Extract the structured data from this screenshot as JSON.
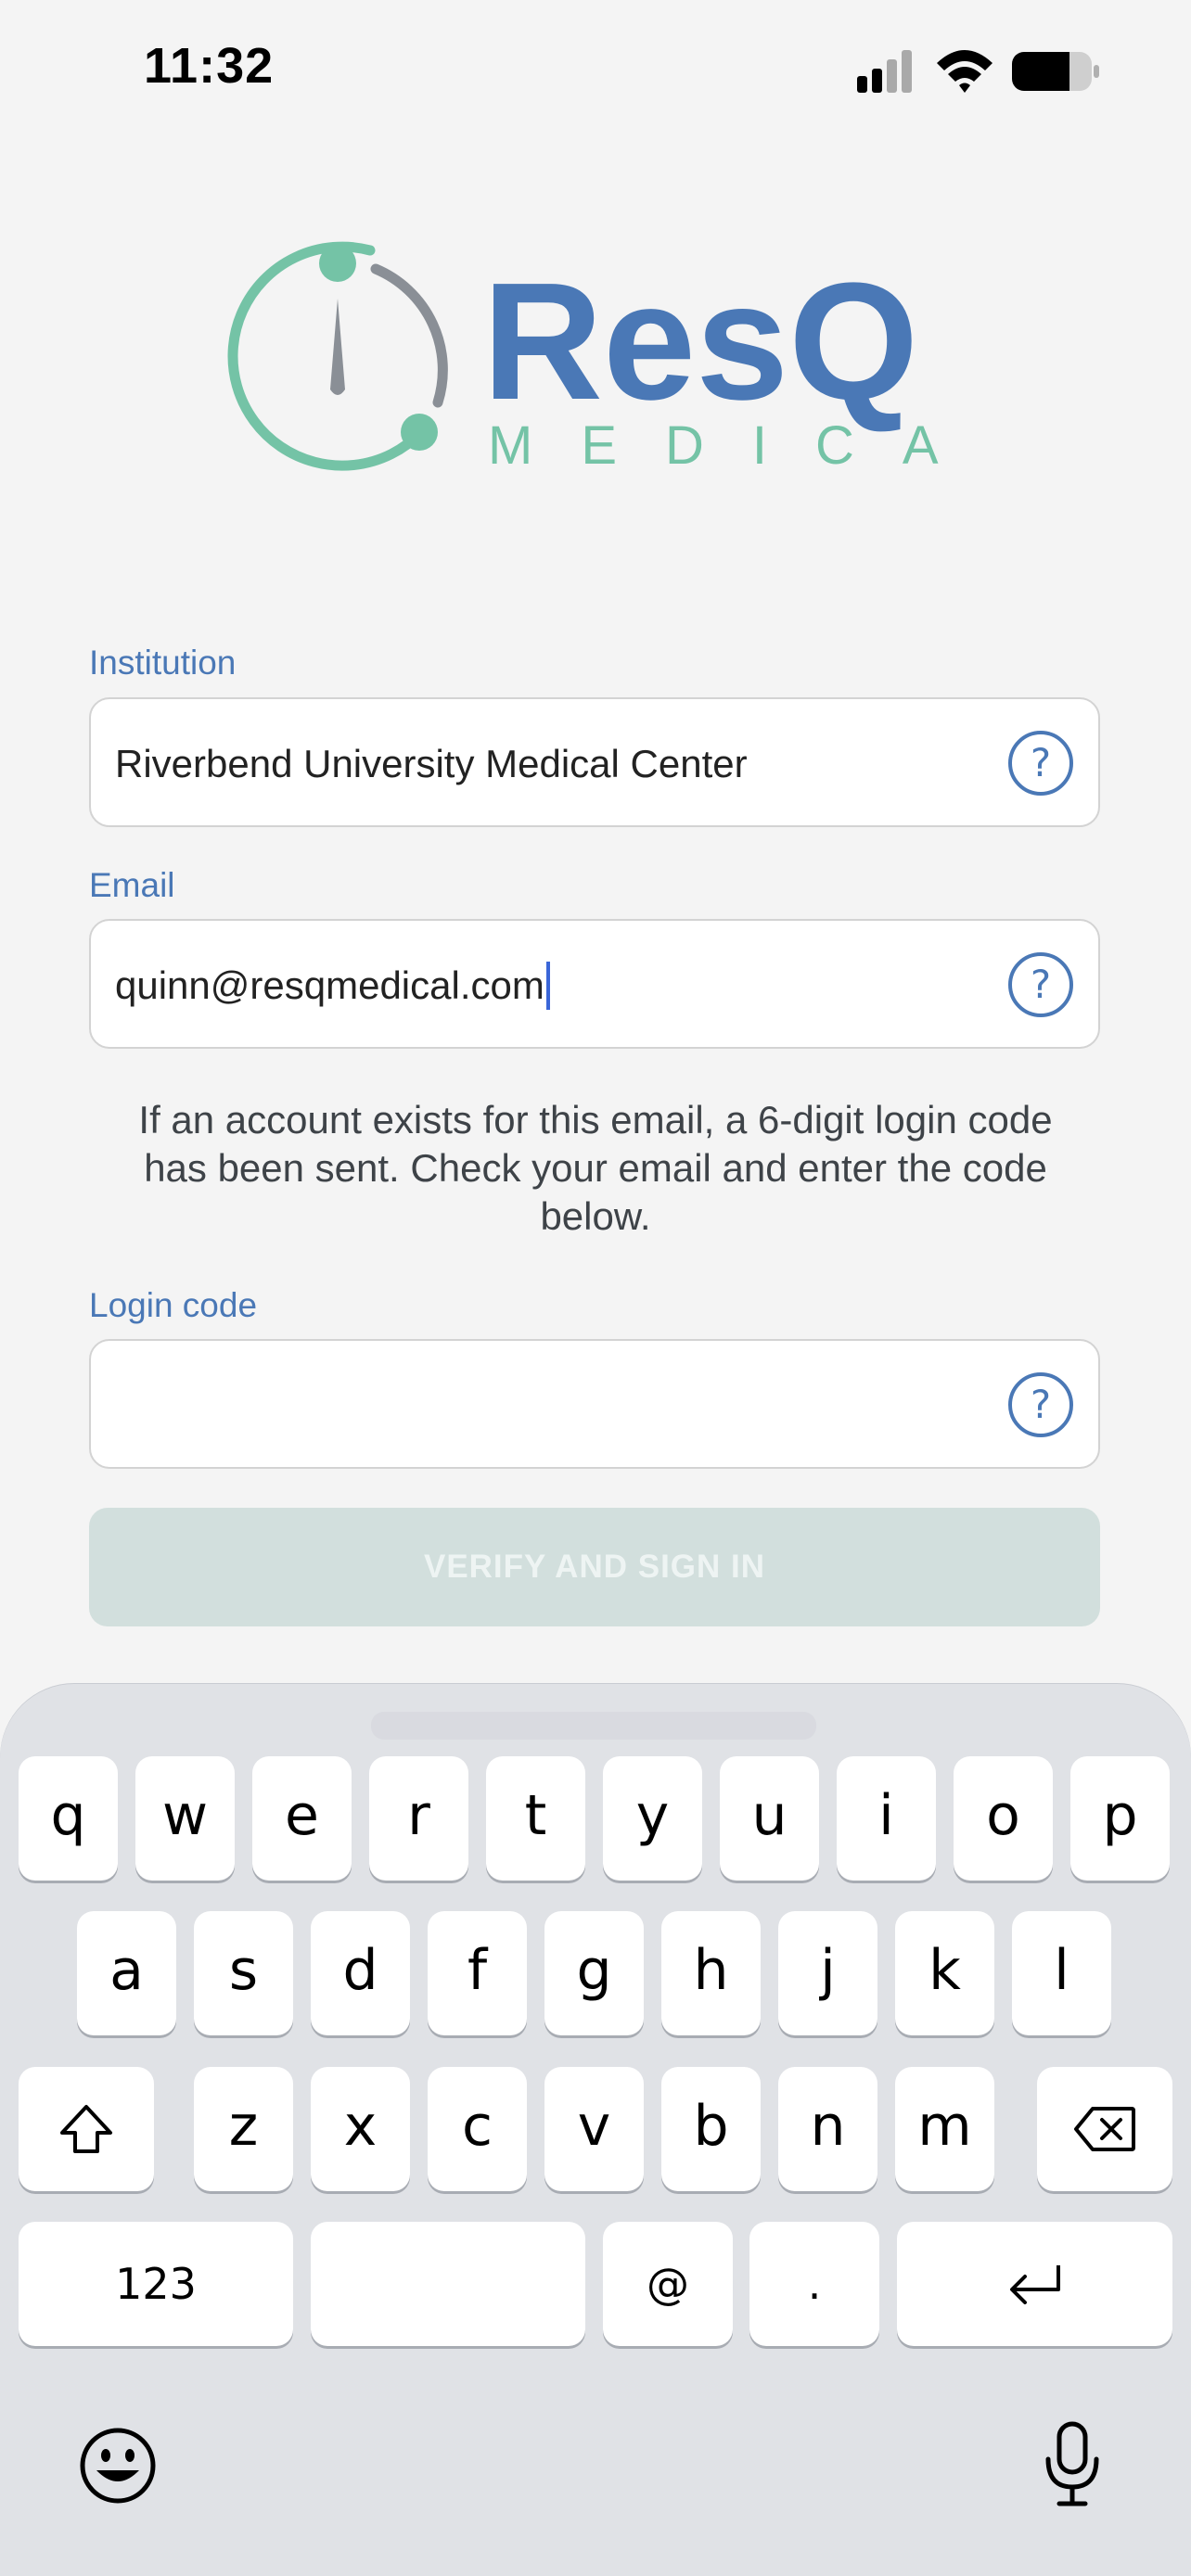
{
  "status": {
    "time": "11:32"
  },
  "brand": {
    "name": "ResQ",
    "subtitle": "MEDICAL"
  },
  "form": {
    "institution": {
      "label": "Institution",
      "value": "Riverbend University Medical Center"
    },
    "email": {
      "label": "Email",
      "value": "quinn@resqmedical.com"
    },
    "info": "If an account exists for this email, a 6-digit login code has been sent. Check your email and enter the code below.",
    "login_code": {
      "label": "Login code",
      "value": ""
    },
    "verify_button": "VERIFY AND SIGN IN"
  },
  "keyboard": {
    "row1": [
      "q",
      "w",
      "e",
      "r",
      "t",
      "y",
      "u",
      "i",
      "o",
      "p"
    ],
    "row2": [
      "a",
      "s",
      "d",
      "f",
      "g",
      "h",
      "j",
      "k",
      "l"
    ],
    "row3": [
      "z",
      "x",
      "c",
      "v",
      "b",
      "n",
      "m"
    ],
    "numbers_key": "123",
    "at_key": "@",
    "dot_key": "."
  },
  "colors": {
    "brand_blue": "#4a78b6",
    "brand_teal": "#74c3a6",
    "dial_gray": "#8a8f96",
    "button_disabled": "#d2dfdd"
  },
  "icons": [
    "signal-icon",
    "wifi-icon",
    "battery-icon",
    "help-icon",
    "shift-icon",
    "backspace-icon",
    "return-icon",
    "emoji-icon",
    "microphone-icon"
  ]
}
